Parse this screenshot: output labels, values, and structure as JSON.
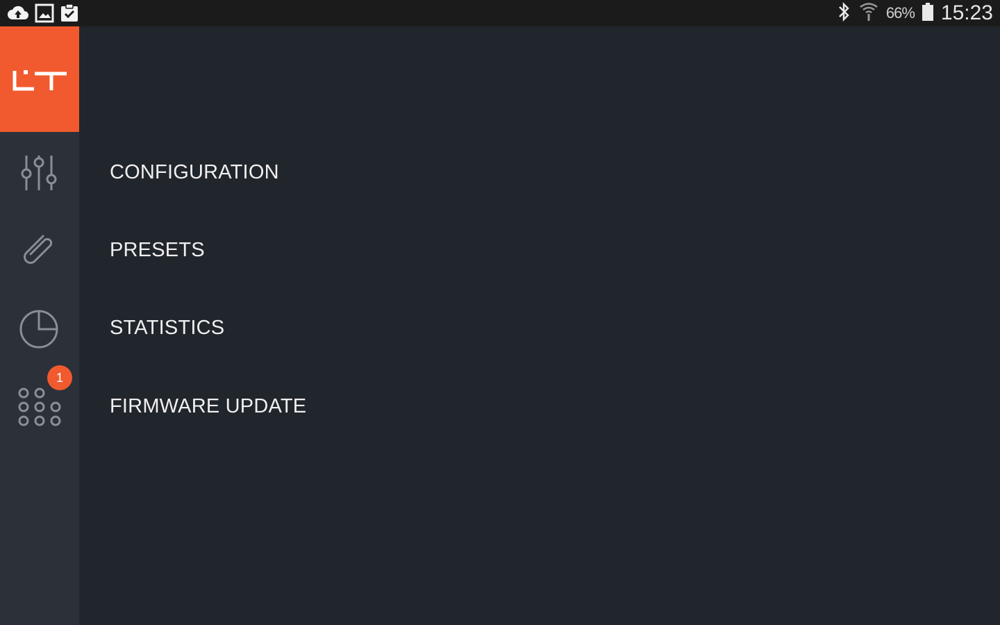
{
  "status_bar": {
    "left_icons": [
      "cloud-upload-icon",
      "image-icon",
      "clipboard-check-icon"
    ],
    "right_icons": [
      "bluetooth-icon",
      "wifi-icon",
      "battery-icon"
    ],
    "battery_percent": "66%",
    "time": "15:23"
  },
  "sidebar": {
    "logo_icon": "lt-logo",
    "brand_color": "#f15a2e",
    "items": [
      {
        "icon": "sliders-icon"
      },
      {
        "icon": "paperclip-icon"
      },
      {
        "icon": "pie-chart-icon"
      },
      {
        "icon": "dot-grid-icon",
        "badge": "1"
      }
    ]
  },
  "menu": {
    "items": [
      {
        "label": "CONFIGURATION"
      },
      {
        "label": "PRESETS"
      },
      {
        "label": "STATISTICS"
      },
      {
        "label": "FIRMWARE UPDATE"
      }
    ]
  }
}
